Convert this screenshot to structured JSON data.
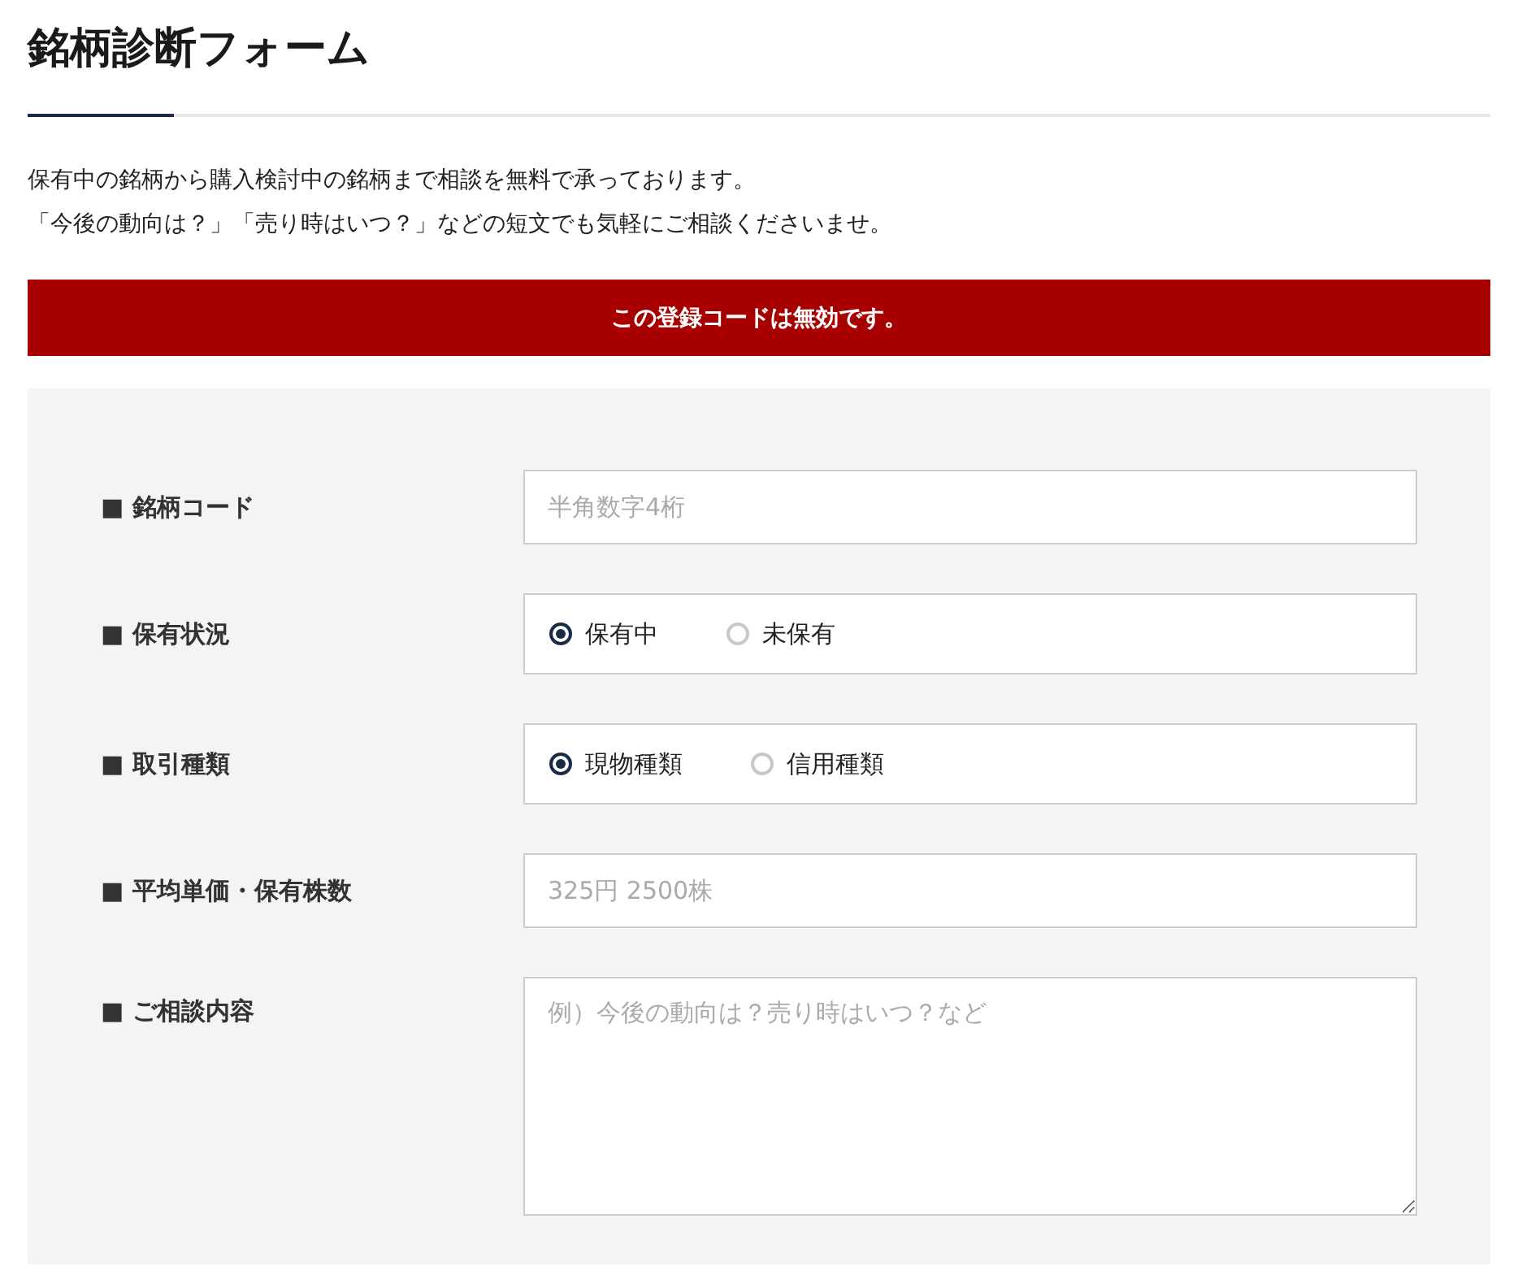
{
  "title": "銘柄診断フォーム",
  "intro": [
    "保有中の銘柄から購入検討中の銘柄まで相談を無料で承っております。",
    "「今後の動向は？」「売り時はいつ？」などの短文でも気軽にご相談くださいませ。"
  ],
  "error": "この登録コードは無効です。",
  "fields": [
    {
      "kind": "text",
      "label": "■ 銘柄コード",
      "placeholder": "半角数字4桁"
    },
    {
      "kind": "radio",
      "label": "■ 保有状況",
      "options": [
        {
          "label": "保有中",
          "selected": true
        },
        {
          "label": "未保有",
          "selected": false
        }
      ]
    },
    {
      "kind": "radio",
      "label": "■ 取引種類",
      "options": [
        {
          "label": "現物種類",
          "selected": true
        },
        {
          "label": "信用種類",
          "selected": false
        }
      ]
    },
    {
      "kind": "text",
      "label": "■ 平均単価・保有株数",
      "placeholder": "325円 2500株"
    },
    {
      "kind": "textarea",
      "label": "■ ご相談内容",
      "placeholder": "例）今後の動向は？売り時はいつ？など"
    }
  ]
}
